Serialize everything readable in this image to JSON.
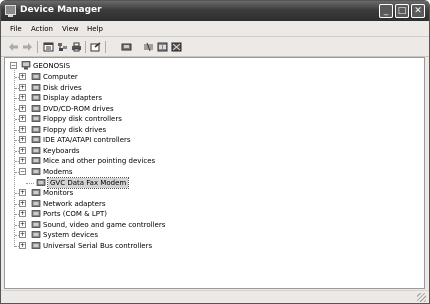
{
  "window": {
    "title": "Device Manager"
  },
  "title_buttons": {
    "minimize": "_",
    "maximize": "□",
    "close": "✕"
  },
  "menu": [
    "File",
    "Action",
    "View",
    "Help"
  ],
  "toolbar": {
    "tools": [
      "back-icon",
      "forward-icon",
      "properties-pane-icon",
      "tree-icon",
      "print-icon",
      "properties-icon",
      "help-icon",
      "scan-icon",
      "update-driver-icon",
      "uninstall-icon"
    ]
  },
  "tree": {
    "root": "GEONOSIS",
    "expand_plus": "+",
    "expand_minus": "−",
    "categories": [
      {
        "label": "Computer",
        "icon": "computer-icon"
      },
      {
        "label": "Disk drives",
        "icon": "disk-drive-icon"
      },
      {
        "label": "Display adapters",
        "icon": "display-adapter-icon"
      },
      {
        "label": "DVD/CD-ROM drives",
        "icon": "cdrom-icon"
      },
      {
        "label": "Floppy disk controllers",
        "icon": "floppy-controller-icon"
      },
      {
        "label": "Floppy disk drives",
        "icon": "floppy-drive-icon"
      },
      {
        "label": "IDE ATA/ATAPI controllers",
        "icon": "ide-controller-icon"
      },
      {
        "label": "Keyboards",
        "icon": "keyboard-icon"
      },
      {
        "label": "Mice and other pointing devices",
        "icon": "mouse-icon"
      },
      {
        "label": "Modems",
        "icon": "modem-icon",
        "expanded": true,
        "children": [
          {
            "label": "GVC Data Fax Modem",
            "icon": "modem-device-icon",
            "selected": true
          }
        ]
      },
      {
        "label": "Monitors",
        "icon": "monitor-icon"
      },
      {
        "label": "Network adapters",
        "icon": "network-adapter-icon"
      },
      {
        "label": "Ports (COM & LPT)",
        "icon": "port-icon"
      },
      {
        "label": "Sound, video and game controllers",
        "icon": "sound-icon"
      },
      {
        "label": "System devices",
        "icon": "system-device-icon"
      },
      {
        "label": "Universal Serial Bus controllers",
        "icon": "usb-icon"
      }
    ]
  },
  "colors": {
    "titlebar": "#3c3c3c",
    "selection": "#d4d4d4",
    "window_bg": "#ece9e6"
  }
}
